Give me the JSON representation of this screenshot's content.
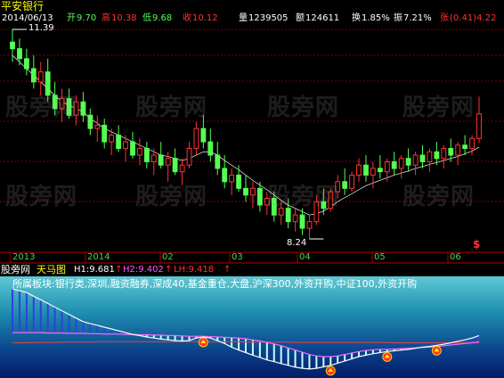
{
  "stock_name": "平安银行",
  "quote": {
    "date": "2014/06/13",
    "open_label": "开",
    "open": "9.70",
    "high_label": "高",
    "high": "10.38",
    "low_label": "低",
    "low": "9.68",
    "close_label": "收",
    "close": "10.12",
    "volume_label": "量",
    "volume": "1239505",
    "amount_label": "额",
    "amount": "124611",
    "turnover_label": "换",
    "turnover": "1.85%",
    "amplitude_label": "振",
    "amplitude": "7.21%",
    "change_label": "张",
    "change": "(0.41)4.22"
  },
  "max_label": "11.39",
  "min_label": "8.24",
  "signal_glyph": "$",
  "x_axis_labels": [
    "2013",
    "2014",
    "02",
    "03",
    "04",
    "05",
    "06"
  ],
  "indicator": {
    "site": "股旁网",
    "name": "天马图",
    "h1": "H1:9.681",
    "h2": "H2:9.402",
    "lh": "LH:9.418",
    "tagline": "所属板块:银行类,深圳,融资融券,深成40,基金重仓,大盘,沪深300,外资开购,中证100,外资开购"
  },
  "watermark": "股旁网",
  "colors": {
    "up": "#ff3232",
    "down": "#00ffff",
    "flat": "#54ff54",
    "ma": "#ffffff",
    "grid": "#7f0000"
  },
  "chart_data": {
    "type": "candlestick",
    "price_range": [
      8.24,
      11.39
    ],
    "price_high_marker": 11.39,
    "price_low_marker": 8.24,
    "candles": [
      [
        11.2,
        11.39,
        10.9,
        11.1
      ],
      [
        11.1,
        11.25,
        10.85,
        10.95
      ],
      [
        10.95,
        11.1,
        10.7,
        10.8
      ],
      [
        10.8,
        11.0,
        10.5,
        10.6
      ],
      [
        10.6,
        10.9,
        10.4,
        10.75
      ],
      [
        10.75,
        10.95,
        10.3,
        10.4
      ],
      [
        10.4,
        10.6,
        10.1,
        10.2
      ],
      [
        10.2,
        10.5,
        10.0,
        10.35
      ],
      [
        10.35,
        10.5,
        10.05,
        10.1
      ],
      [
        10.1,
        10.4,
        9.95,
        10.3
      ],
      [
        10.3,
        10.45,
        10.0,
        10.1
      ],
      [
        10.1,
        10.2,
        9.8,
        9.9
      ],
      [
        9.9,
        10.1,
        9.7,
        9.95
      ],
      [
        9.95,
        10.05,
        9.6,
        9.7
      ],
      [
        9.7,
        9.9,
        9.5,
        9.8
      ],
      [
        9.8,
        9.95,
        9.55,
        9.6
      ],
      [
        9.6,
        9.8,
        9.4,
        9.7
      ],
      [
        9.7,
        9.85,
        9.45,
        9.5
      ],
      [
        9.5,
        9.75,
        9.35,
        9.6
      ],
      [
        9.6,
        9.7,
        9.3,
        9.4
      ],
      [
        9.4,
        9.6,
        9.2,
        9.5
      ],
      [
        9.5,
        9.7,
        9.3,
        9.35
      ],
      [
        9.35,
        9.55,
        9.1,
        9.45
      ],
      [
        9.45,
        9.6,
        9.2,
        9.25
      ],
      [
        9.25,
        9.45,
        9.05,
        9.35
      ],
      [
        9.35,
        9.7,
        9.3,
        9.6
      ],
      [
        9.6,
        10.0,
        9.5,
        9.9
      ],
      [
        9.9,
        10.1,
        9.6,
        9.7
      ],
      [
        9.7,
        9.9,
        9.4,
        9.5
      ],
      [
        9.5,
        9.7,
        9.2,
        9.3
      ],
      [
        9.3,
        9.5,
        9.0,
        9.1
      ],
      [
        9.1,
        9.3,
        8.9,
        9.2
      ],
      [
        9.2,
        9.35,
        8.95,
        9.0
      ],
      [
        9.0,
        9.2,
        8.8,
        8.9
      ],
      [
        8.9,
        9.1,
        8.7,
        9.0
      ],
      [
        9.0,
        9.1,
        8.65,
        8.75
      ],
      [
        8.75,
        8.95,
        8.6,
        8.85
      ],
      [
        8.85,
        8.95,
        8.5,
        8.6
      ],
      [
        8.6,
        8.8,
        8.45,
        8.7
      ],
      [
        8.7,
        8.85,
        8.4,
        8.5
      ],
      [
        8.5,
        8.7,
        8.35,
        8.6
      ],
      [
        8.6,
        8.7,
        8.3,
        8.4
      ],
      [
        8.4,
        8.6,
        8.24,
        8.5
      ],
      [
        8.5,
        8.9,
        8.45,
        8.8
      ],
      [
        8.8,
        9.0,
        8.6,
        8.7
      ],
      [
        8.7,
        9.0,
        8.65,
        8.95
      ],
      [
        8.95,
        9.2,
        8.85,
        9.1
      ],
      [
        9.1,
        9.3,
        8.9,
        9.0
      ],
      [
        9.0,
        9.25,
        8.95,
        9.2
      ],
      [
        9.2,
        9.45,
        9.1,
        9.35
      ],
      [
        9.35,
        9.5,
        9.1,
        9.2
      ],
      [
        9.2,
        9.4,
        9.0,
        9.3
      ],
      [
        9.3,
        9.5,
        9.15,
        9.25
      ],
      [
        9.25,
        9.45,
        9.1,
        9.4
      ],
      [
        9.4,
        9.55,
        9.2,
        9.3
      ],
      [
        9.3,
        9.5,
        9.15,
        9.45
      ],
      [
        9.45,
        9.6,
        9.25,
        9.35
      ],
      [
        9.35,
        9.55,
        9.2,
        9.5
      ],
      [
        9.5,
        9.65,
        9.3,
        9.4
      ],
      [
        9.4,
        9.6,
        9.25,
        9.55
      ],
      [
        9.55,
        9.7,
        9.35,
        9.45
      ],
      [
        9.45,
        9.65,
        9.3,
        9.6
      ],
      [
        9.6,
        9.75,
        9.4,
        9.5
      ],
      [
        9.5,
        9.7,
        9.35,
        9.65
      ],
      [
        9.65,
        9.8,
        9.5,
        9.6
      ],
      [
        9.6,
        9.8,
        9.5,
        9.75
      ],
      [
        9.75,
        10.38,
        9.68,
        10.12
      ]
    ],
    "ma": [
      11.0,
      10.9,
      10.8,
      10.7,
      10.6,
      10.5,
      10.4,
      10.3,
      10.25,
      10.2,
      10.15,
      10.05,
      9.98,
      9.9,
      9.85,
      9.8,
      9.75,
      9.7,
      9.65,
      9.6,
      9.55,
      9.5,
      9.48,
      9.45,
      9.42,
      9.45,
      9.5,
      9.55,
      9.55,
      9.5,
      9.42,
      9.35,
      9.28,
      9.2,
      9.12,
      9.05,
      8.98,
      8.9,
      8.82,
      8.75,
      8.7,
      8.65,
      8.6,
      8.62,
      8.66,
      8.72,
      8.8,
      8.86,
      8.92,
      8.98,
      9.04,
      9.08,
      9.12,
      9.16,
      9.2,
      9.23,
      9.26,
      9.3,
      9.33,
      9.36,
      9.39,
      9.42,
      9.45,
      9.48,
      9.52,
      9.56,
      9.62
    ],
    "indicator_series": {
      "upper": [
        10.9,
        10.85,
        10.8,
        10.7,
        10.6,
        10.5,
        10.4,
        10.3,
        10.2,
        10.1,
        10.0,
        9.95,
        9.9,
        9.85,
        9.8,
        9.75,
        9.7,
        9.65,
        9.62,
        9.58,
        9.55,
        9.52,
        9.5,
        9.48,
        9.47,
        9.48,
        9.55,
        9.58,
        9.55,
        9.48,
        9.4,
        9.3,
        9.22,
        9.15,
        9.08,
        9.02,
        8.95,
        8.9,
        8.85,
        8.8,
        8.75,
        8.72,
        8.7,
        8.72,
        8.76,
        8.8,
        8.86,
        8.92,
        8.98,
        9.04,
        9.08,
        9.12,
        9.15,
        9.18,
        9.2,
        9.22,
        9.24,
        9.27,
        9.3,
        9.32,
        9.35,
        9.38,
        9.42,
        9.46,
        9.5,
        9.55,
        9.62
      ],
      "lower": [
        9.7,
        9.7,
        9.7,
        9.7,
        9.7,
        9.69,
        9.69,
        9.69,
        9.68,
        9.68,
        9.68,
        9.67,
        9.67,
        9.66,
        9.66,
        9.66,
        9.65,
        9.65,
        9.64,
        9.64,
        9.63,
        9.63,
        9.62,
        9.62,
        9.61,
        9.6,
        9.6,
        9.6,
        9.59,
        9.58,
        9.57,
        9.56,
        9.55,
        9.53,
        9.5,
        9.47,
        9.43,
        9.39,
        9.34,
        9.28,
        9.22,
        9.16,
        9.1,
        9.06,
        9.04,
        9.04,
        9.06,
        9.1,
        9.14,
        9.18,
        9.21,
        9.23,
        9.24,
        9.24,
        9.25,
        9.26,
        9.27,
        9.28,
        9.29,
        9.3,
        9.32,
        9.34,
        9.36,
        9.38,
        9.4,
        9.42,
        9.45
      ],
      "ref": [
        9.42,
        9.42,
        9.42,
        9.43,
        9.43,
        9.43,
        9.43,
        9.44,
        9.44,
        9.44,
        9.44,
        9.44,
        9.45,
        9.45,
        9.45,
        9.45,
        9.45,
        9.45,
        9.45,
        9.45,
        9.45,
        9.45,
        9.45,
        9.45,
        9.45,
        9.45,
        9.45,
        9.45,
        9.45,
        9.45,
        9.45,
        9.45,
        9.45,
        9.44,
        9.44,
        9.44,
        9.44,
        9.44,
        9.44,
        9.44,
        9.43,
        9.43,
        9.43,
        9.43,
        9.43,
        9.43,
        9.43,
        9.43,
        9.43,
        9.43,
        9.43,
        9.43,
        9.43,
        9.43,
        9.42,
        9.42,
        9.42,
        9.42,
        9.42,
        9.42,
        9.42,
        9.42,
        9.42,
        9.42,
        9.42,
        9.42,
        9.42
      ]
    },
    "signals": [
      27,
      45,
      53,
      60
    ]
  }
}
